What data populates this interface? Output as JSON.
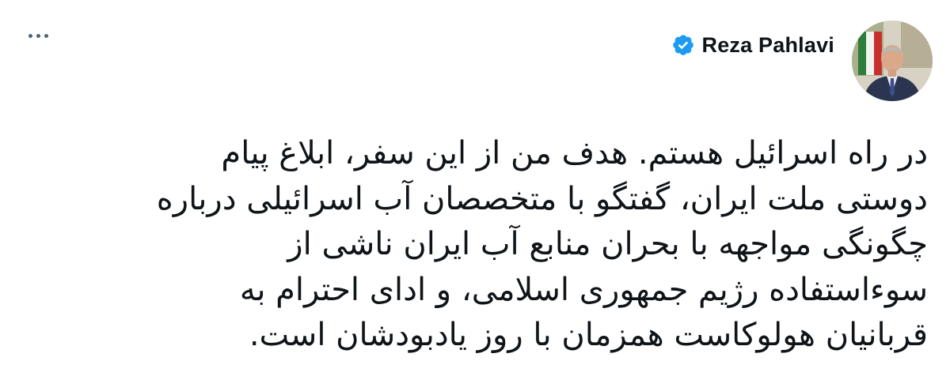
{
  "author": {
    "display_name": "Reza Pahlavi",
    "verified": true,
    "verified_color": "#1d9bf0",
    "avatar_icon": "profile-photo"
  },
  "more_menu": {
    "icon": "more-horizontal-icon"
  },
  "tweet": {
    "lines": [
      "در راه اسرائیل هستم. هدف من از این سفر، ابلاغ پیام",
      "دوستی ملت ایران، گفتگو با متخصصان آب اسرائیلی درباره",
      "چگونگی مواجهه با بحران منابع آب ایران ناشی از",
      "سوءاستفاده رژیم جمهوری اسلامی، و ادای احترام به",
      "قربانیان هولوکاست همزمان با روز یادبودشان است."
    ]
  },
  "colors": {
    "text": "#0f1419",
    "secondary": "#536471",
    "background": "#ffffff"
  }
}
